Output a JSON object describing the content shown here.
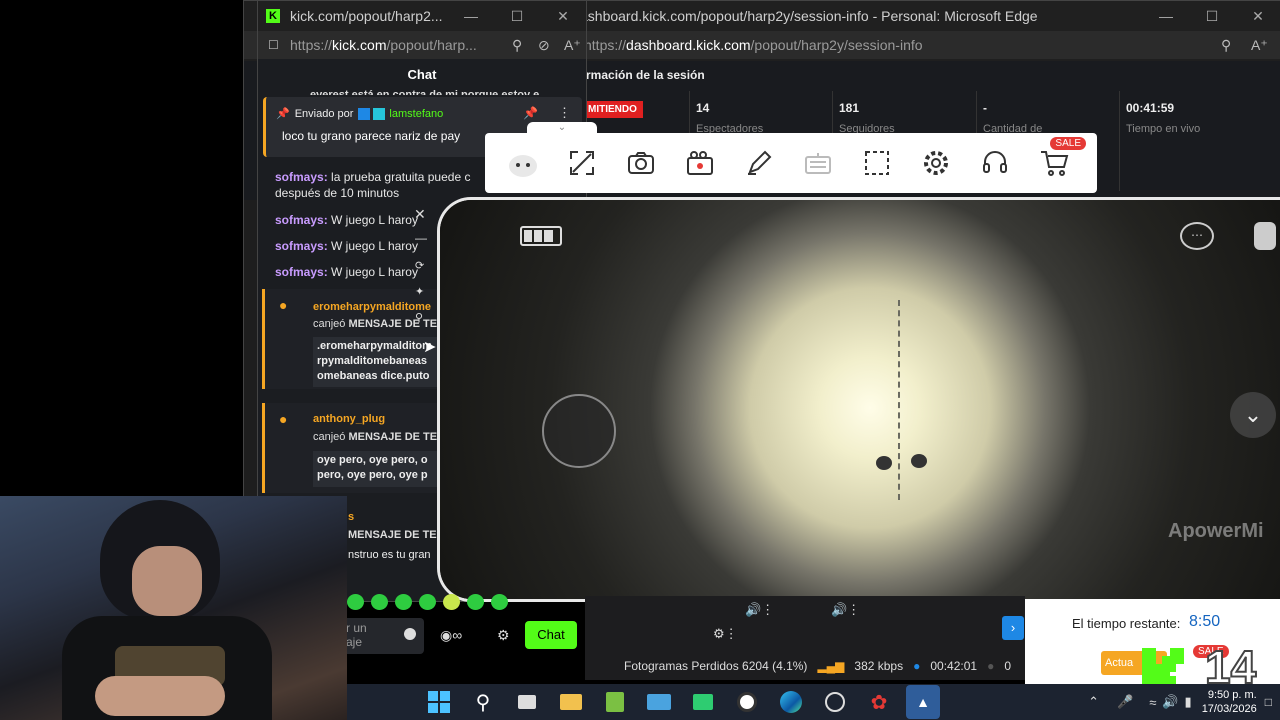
{
  "edge_dashboard": {
    "title": "ashboard.kick.com/popout/harp2y/session-info - Personal: Microsoft Edge",
    "url_prefix": "https://",
    "url_host": "dashboard.kick.com",
    "url_path": "/popout/harp2y/session-info",
    "section_title": "rmación de la sesión",
    "live_badge": "MITIENDO",
    "stats": [
      {
        "value": "14",
        "label": "Espectadores"
      },
      {
        "value": "181",
        "label": "Seguidores"
      },
      {
        "value": "-",
        "label": "Cantidad de"
      },
      {
        "value": "00:41:59",
        "label": "Tiempo en vivo"
      }
    ]
  },
  "edge_chat": {
    "title": "kick.com/popout/harp2...",
    "url_prefix": "https://",
    "url_host": "kick.com",
    "url_path": "/popout/harp...",
    "header": "Chat",
    "top_cut": "everest está en contra de mi porque estoy e",
    "pinned_by": "Enviado por",
    "pinned_user": "lamstefano",
    "pinned_msg": "loco tu grano parece nariz de pay",
    "messages": [
      {
        "user": "sofmays:",
        "text": " la prueba gratuita puede c",
        "text2": "después de 10 minutos"
      },
      {
        "user": "sofmays:",
        "text": " W juego L haroy"
      },
      {
        "user": "sofmays:",
        "text": " W juego L haroy"
      },
      {
        "user": "sofmays:",
        "text": " W juego L haroy"
      }
    ],
    "redeems": [
      {
        "user": "eromeharpymalditome",
        "action": "canjeó ",
        "reward": "MENSAJE DE TE",
        "box": [
          ".eromeharpymalditom",
          "rpymalditomebaneas",
          "omebaneas dice.puto"
        ]
      },
      {
        "user": "anthony_plug",
        "action": "canjeó ",
        "reward": "MENSAJE DE TE",
        "box": [
          "oye pero, oye pero, o",
          "pero, oye pero, oye p"
        ]
      }
    ],
    "partial_redeem_user": "s",
    "partial_redeem": "MENSAJE DE TE",
    "partial_msg": "nstruo es tu gran",
    "input_placeholder_1": "r un",
    "input_placeholder_2": "aje",
    "chat_button": "Chat"
  },
  "apowermirror": {
    "toolbar_sale": "SALE",
    "watermark": "ApowerMi",
    "icons": [
      "mascot-icon",
      "fullscreen-icon",
      "screenshot-icon",
      "record-icon",
      "draw-icon",
      "keyboard-icon",
      "crop-icon",
      "settings-icon",
      "support-icon",
      "cart-icon"
    ]
  },
  "obs_status": {
    "dropped_frames": "Fotogramas Perdidos 6204 (4.1%)",
    "bitrate": "382 kbps",
    "time": "00:42:01",
    "extra": "0"
  },
  "timer_overlay": {
    "label": "El tiempo restante:",
    "value": "8:50",
    "button": "Actua",
    "sale": "SALE",
    "count": "14"
  },
  "taskbar": {
    "time": "9:50 p. m.",
    "date": "17/03/2026",
    "icons": [
      "windows-start-icon",
      "search-icon",
      "task-view-icon",
      "file-explorer-icon",
      "notepad-plus-icon",
      "photos-icon",
      "store-icon",
      "obs-icon",
      "edge-icon",
      "browser-icon",
      "maps-icon",
      "apowermirror-icon"
    ]
  },
  "colors": {
    "kick_green": "#53fc18",
    "live_red": "#e02020",
    "accent_blue": "#1e88e5"
  }
}
